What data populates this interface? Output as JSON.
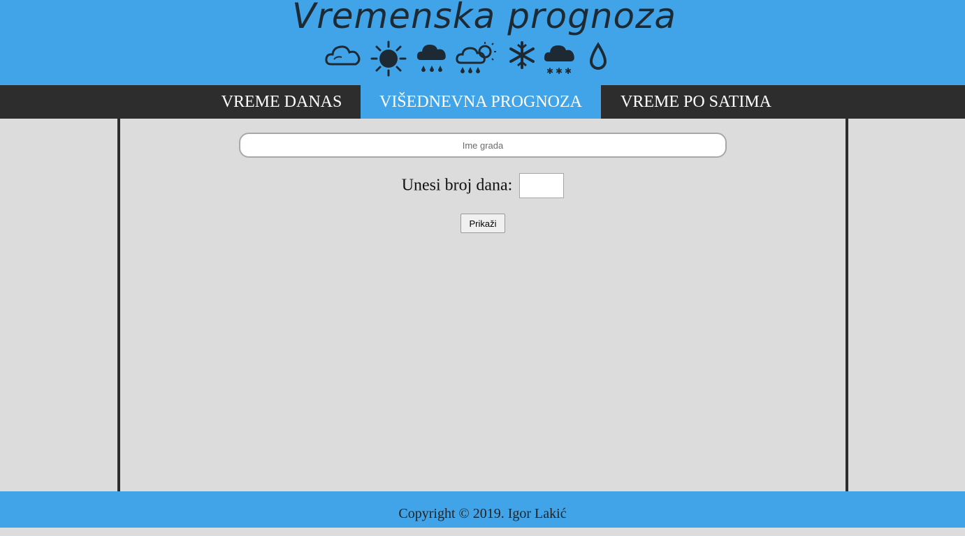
{
  "header": {
    "title": "Vremenska prognoza",
    "icons": [
      "cloud-icon",
      "sun-icon",
      "rain-icon",
      "partly-sunny-rain-icon",
      "snowflake-icon",
      "snow-cloud-icon",
      "drop-icon"
    ]
  },
  "nav": {
    "items": [
      {
        "label": "VREME DANAS",
        "active": false
      },
      {
        "label": "VIŠEDNEVNA PROGNOZA",
        "active": true
      },
      {
        "label": "VREME PO SATIMA",
        "active": false
      }
    ]
  },
  "form": {
    "city_placeholder": "Ime grada",
    "city_value": "",
    "days_label": "Unesi broj dana:",
    "days_value": "",
    "submit_label": "Prikaži"
  },
  "footer": {
    "text": "Copyright © 2019. Igor Lakić"
  },
  "colors": {
    "header_bg": "#42a4e8",
    "nav_bg": "#2d2d2d",
    "content_bg": "#dcdcdc",
    "active_tab": "#42a4e8"
  }
}
